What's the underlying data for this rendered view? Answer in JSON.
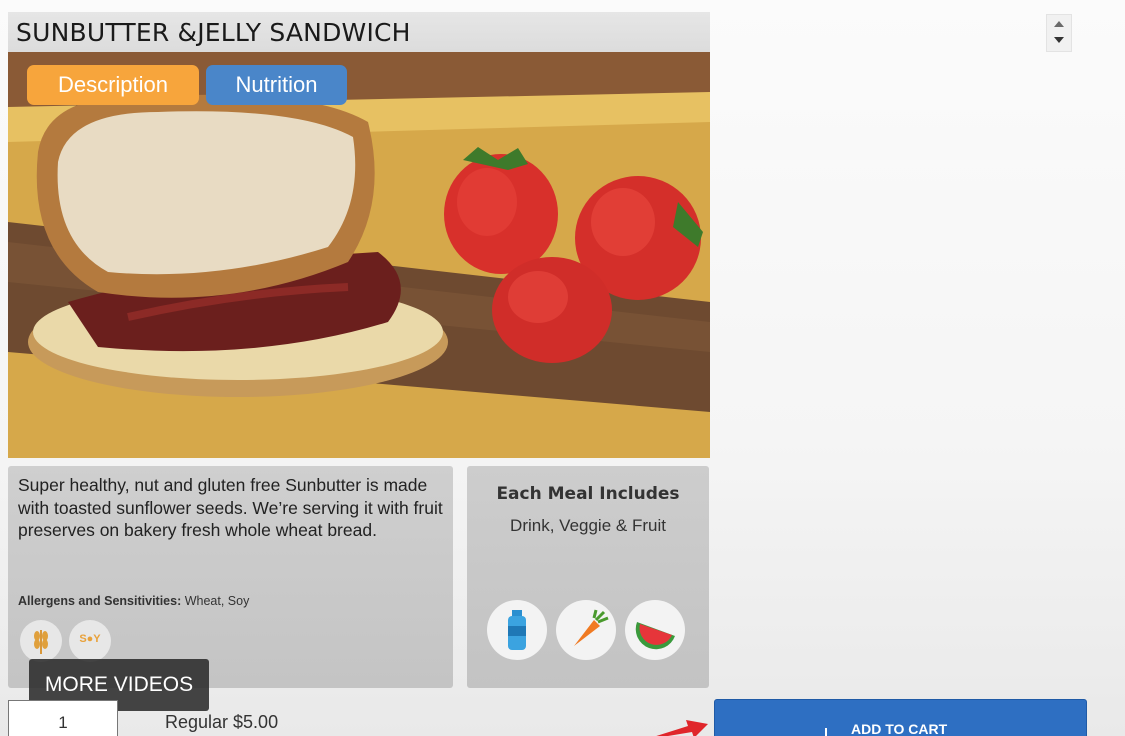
{
  "product": {
    "title": "SUNBUTTER &JELLY SANDWICH",
    "tabs": [
      {
        "label": "Description",
        "color": "#f7a53c"
      },
      {
        "label": "Nutrition",
        "color": "#4a86c9"
      }
    ],
    "description": "Super healthy, nut and gluten free Sunbutter is made with toasted sunflower seeds. We’re serving it with fruit preserves on bakery fresh whole wheat bread.",
    "allergens_label": "Allergens and Sensitivities:",
    "allergens_value": "Wheat, Soy",
    "allergen_icons": [
      "wheat-icon",
      "soy-icon"
    ],
    "soy_icon_text": "S●Y"
  },
  "meal": {
    "title": "Each Meal Includes",
    "subtitle": "Drink, Veggie & Fruit",
    "icons": [
      "water-bottle-icon",
      "carrot-icon",
      "watermelon-icon"
    ]
  },
  "order": {
    "quantity": "1",
    "price": "Regular $5.00",
    "add_to_cart": "ADD TO CART"
  },
  "overlay": {
    "more_videos": "MORE VIDEOS"
  },
  "colors": {
    "accent_blue": "#2e6fc2",
    "tab_orange": "#f7a53c",
    "tab_blue": "#4a86c9",
    "annotation_red": "#e0262b"
  }
}
